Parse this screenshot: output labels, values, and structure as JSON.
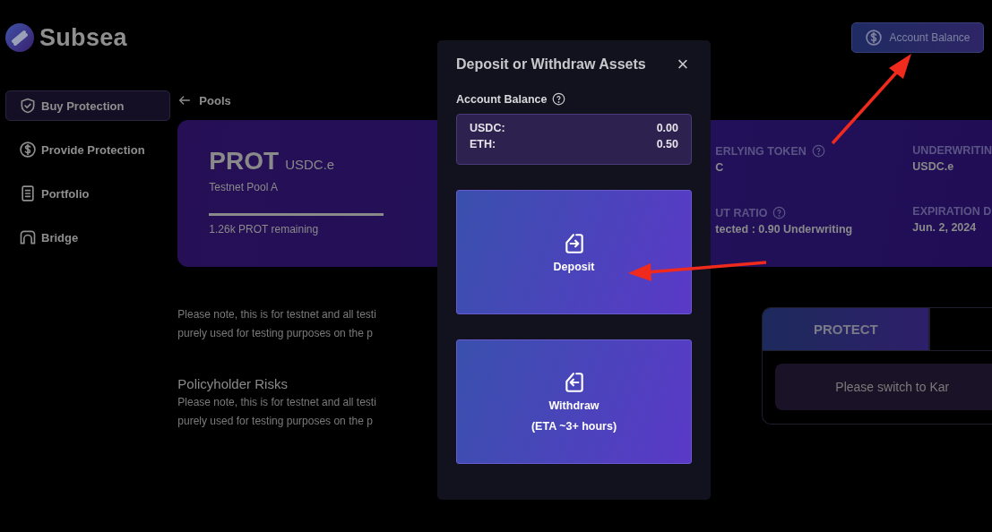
{
  "app": {
    "name": "Subsea"
  },
  "header": {
    "account_button": "Account Balance"
  },
  "sidebar": {
    "items": [
      {
        "label": "Buy Protection",
        "selected": true
      },
      {
        "label": "Provide Protection",
        "selected": false
      },
      {
        "label": "Portfolio",
        "selected": false
      },
      {
        "label": "Bridge",
        "selected": false
      }
    ]
  },
  "back_link": "Pools",
  "pool_card": {
    "symbol": "PROT",
    "token": "USDC.e",
    "name": "Testnet Pool A",
    "level": 1,
    "remaining": "1.26k PROT remaining",
    "stat_columns": [
      [
        {
          "label": "ERLYING TOKEN",
          "help": true,
          "value": "C"
        },
        {
          "label": "UT RATIO",
          "help": true,
          "value": "tected : 0.90 Underwriting"
        }
      ],
      [
        {
          "label": "UNDERWRITIN",
          "help": false,
          "value": "USDC.e"
        },
        {
          "label": "EXPIRATION D",
          "help": false,
          "value": "Jun. 2, 2024"
        }
      ]
    ]
  },
  "notes": [
    {
      "kind": "paragraph",
      "lines": [
        "Please note, this is for testnet and all testi",
        "purely used for testing purposes on the p"
      ]
    },
    {
      "kind": "heading",
      "text": "Policyholder Risks"
    },
    {
      "kind": "paragraph",
      "lines": [
        "Please note, this is for testnet and all testi",
        "purely used for testing purposes on the p"
      ]
    }
  ],
  "trade_panel": {
    "tabs": [
      {
        "label": "PROTECT",
        "selected": true
      }
    ],
    "message": "Please switch to Kar"
  },
  "modal": {
    "title": "Deposit or Withdraw Assets",
    "close": "×",
    "balance_label": "Account Balance",
    "balances": [
      {
        "asset": "USDC:",
        "amount": "0.00"
      },
      {
        "asset": "ETH:",
        "amount": "0.50"
      }
    ],
    "actions": [
      {
        "kind": "deposit",
        "label": "Deposit"
      },
      {
        "kind": "withdraw",
        "label": "Withdraw",
        "note": "(ETA ~3+ hours)"
      }
    ]
  }
}
